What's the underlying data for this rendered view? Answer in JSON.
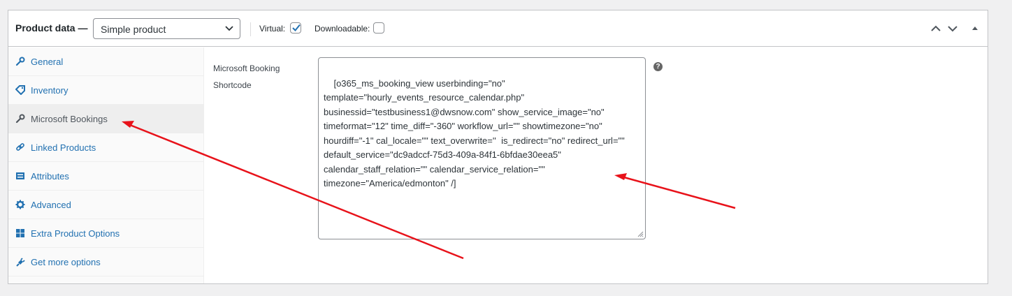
{
  "header": {
    "title": "Product data —",
    "product_type": "Simple product",
    "virtual_label": "Virtual:",
    "virtual_checked": true,
    "downloadable_label": "Downloadable:",
    "downloadable_checked": false
  },
  "tabs": [
    {
      "label": "General",
      "icon": "wrench-icon",
      "active": false
    },
    {
      "label": "Inventory",
      "icon": "tag-icon",
      "active": false
    },
    {
      "label": "Microsoft Bookings",
      "icon": "wrench-icon",
      "active": true
    },
    {
      "label": "Linked Products",
      "icon": "link-icon",
      "active": false
    },
    {
      "label": "Attributes",
      "icon": "list-icon",
      "active": false
    },
    {
      "label": "Advanced",
      "icon": "gear-icon",
      "active": false
    },
    {
      "label": "Extra Product Options",
      "icon": "grid-icon",
      "active": false
    },
    {
      "label": "Get more options",
      "icon": "plugin-icon",
      "active": false
    }
  ],
  "panel": {
    "field_label_line1": "Microsoft Booking",
    "field_label_line2": "Shortcode",
    "shortcode_value": "[o365_ms_booking_view userbinding=\"no\" template=\"hourly_events_resource_calendar.php\" businessid=\"testbusiness1@dwsnow.com\" show_service_image=\"no\" timeformat=\"12\" time_diff=\"-360\" workflow_url=\"\" showtimezone=\"no\" hourdiff=\"-1\" cal_locale=\"\" text_overwrite=''  is_redirect=\"no\" redirect_url=\"\" default_service=\"dc9adccf-75d3-409a-84f1-6bfdae30eea5\" calendar_staff_relation=\"\" calendar_service_relation=\"\" timezone=\"America/edmonton\" /]",
    "help": "?"
  },
  "colors": {
    "link": "#2271b1",
    "arrow": "#e8121a",
    "checkbox_check": "#2271b1"
  }
}
